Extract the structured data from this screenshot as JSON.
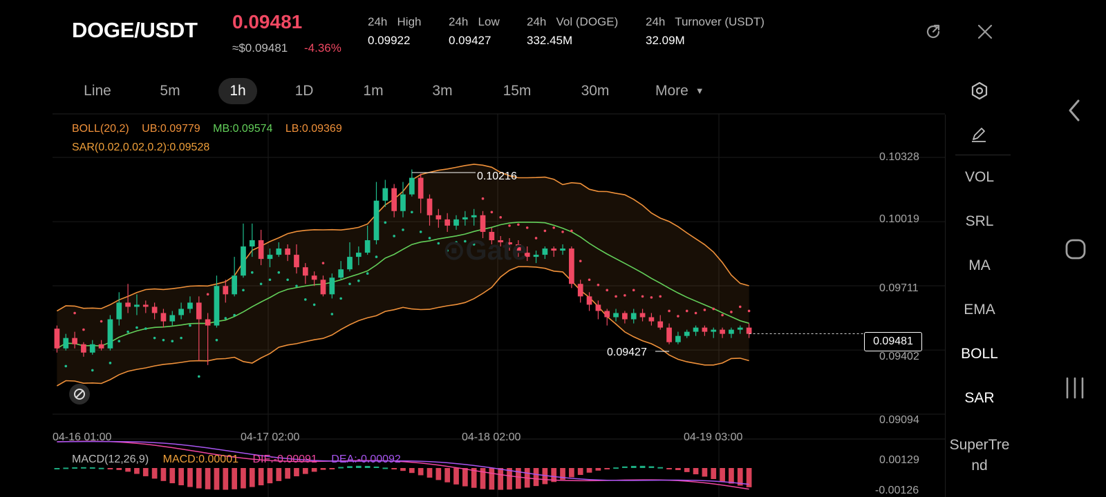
{
  "header": {
    "pair": "DOGE/USDT",
    "price": "0.09481",
    "approx": "≈$0.09481",
    "change": "-4.36%",
    "stats": [
      {
        "label": "24h   High",
        "value": "0.09922"
      },
      {
        "label": "24h   Low",
        "value": "0.09427"
      },
      {
        "label": "24h   Vol (DOGE)",
        "value": "332.45M"
      },
      {
        "label": "24h   Turnover (USDT)",
        "value": "32.09M"
      }
    ],
    "icons": {
      "refresh": "rotate-icon",
      "close": "close-icon"
    }
  },
  "tabs": [
    "Line",
    "5m",
    "1h",
    "1D",
    "1m",
    "3m",
    "15m",
    "30m",
    "More"
  ],
  "active_tab": "1h",
  "indicators": [
    "VOL",
    "SRL",
    "MA",
    "EMA",
    "BOLL",
    "SAR",
    "SuperTrend"
  ],
  "active_indicators": [
    "BOLL",
    "SAR"
  ],
  "legend": {
    "boll": "BOLL(20,2)",
    "ub": "UB:0.09779",
    "mb": "MB:0.09574",
    "lb": "LB:0.09369",
    "sar": "SAR(0.02,0.02,0.2):0.09528",
    "macd_name": "MACD(12,26,9)",
    "macd": "MACD:0.00001",
    "dif": "DIF:-0.00091",
    "dea": "DEA:-0.00092"
  },
  "chart_data": {
    "type": "candlestick",
    "ylim": [
      0.09094,
      0.10328
    ],
    "y_ticks": [
      "0.10328",
      "0.10019",
      "0.09711",
      "0.09402",
      "0.09094"
    ],
    "x_ticks": [
      "04-16 01:00",
      "04-17 02:00",
      "04-18 02:00",
      "04-19 03:00"
    ],
    "high_marker": "0.10216",
    "low_marker": "0.09427",
    "last_price": "0.09481",
    "macd_ticks": [
      "0.00129",
      "-0.00126"
    ],
    "candles": [
      [
        0.09505,
        0.0941,
        0.0952,
        0.0939
      ],
      [
        0.0941,
        0.0946,
        0.0948,
        0.094
      ],
      [
        0.0946,
        0.0943,
        0.0949,
        0.0941
      ],
      [
        0.0943,
        0.0939,
        0.0944,
        0.0937
      ],
      [
        0.0939,
        0.0943,
        0.0945,
        0.0938
      ],
      [
        0.0943,
        0.0941,
        0.0945,
        0.094
      ],
      [
        0.0941,
        0.0955,
        0.0957,
        0.094
      ],
      [
        0.0955,
        0.0963,
        0.0968,
        0.0952
      ],
      [
        0.0963,
        0.0961,
        0.0972,
        0.0958
      ],
      [
        0.0961,
        0.0962,
        0.0967,
        0.0957
      ],
      [
        0.0962,
        0.0961,
        0.0964,
        0.0958
      ],
      [
        0.0961,
        0.0958,
        0.0963,
        0.0955
      ],
      [
        0.0958,
        0.0954,
        0.096,
        0.0951
      ],
      [
        0.0954,
        0.0957,
        0.0959,
        0.0952
      ],
      [
        0.0957,
        0.096,
        0.0963,
        0.0955
      ],
      [
        0.096,
        0.0963,
        0.0966,
        0.0958
      ],
      [
        0.0963,
        0.0955,
        0.0966,
        0.0935
      ],
      [
        0.0955,
        0.0952,
        0.0958,
        0.0933
      ],
      [
        0.0952,
        0.0971,
        0.0976,
        0.0951
      ],
      [
        0.0971,
        0.0967,
        0.0974,
        0.0963
      ],
      [
        0.0967,
        0.0976,
        0.0985,
        0.0966
      ],
      [
        0.0976,
        0.099,
        0.1001,
        0.0975
      ],
      [
        0.099,
        0.0993,
        0.1001,
        0.0985
      ],
      [
        0.0993,
        0.0984,
        0.0998,
        0.0981
      ],
      [
        0.0984,
        0.0986,
        0.0989,
        0.098
      ],
      [
        0.0986,
        0.0989,
        0.0992,
        0.0985
      ],
      [
        0.0989,
        0.0986,
        0.0991,
        0.0983
      ],
      [
        0.0986,
        0.098,
        0.0991,
        0.0977
      ],
      [
        0.098,
        0.0976,
        0.0982,
        0.0972
      ],
      [
        0.0976,
        0.0974,
        0.0978,
        0.0971
      ],
      [
        0.0974,
        0.0967,
        0.0976,
        0.0966
      ],
      [
        0.0967,
        0.0975,
        0.0977,
        0.0965
      ],
      [
        0.0975,
        0.0979,
        0.0983,
        0.0974
      ],
      [
        0.0979,
        0.0985,
        0.0992,
        0.0978
      ],
      [
        0.0985,
        0.0987,
        0.099,
        0.0981
      ],
      [
        0.0987,
        0.0993,
        0.1,
        0.0986
      ],
      [
        0.0993,
        0.1012,
        0.1021,
        0.0991
      ],
      [
        0.1012,
        0.1018,
        0.1022,
        0.1009
      ],
      [
        0.1018,
        0.1007,
        0.102,
        0.1004
      ],
      [
        0.1007,
        0.1015,
        0.1021,
        0.1004
      ],
      [
        0.1015,
        0.1023,
        0.1027,
        0.1014
      ],
      [
        0.1023,
        0.1013,
        0.1025,
        0.1006
      ],
      [
        0.1013,
        0.1005,
        0.1015,
        0.1
      ],
      [
        0.1005,
        0.1003,
        0.1008,
        0.0999
      ],
      [
        0.1003,
        0.1,
        0.1006,
        0.0997
      ],
      [
        0.1,
        0.1003,
        0.1005,
        0.0998
      ],
      [
        0.1003,
        0.1004,
        0.1007,
        0.1
      ],
      [
        0.1004,
        0.1005,
        0.1008,
        0.1
      ],
      [
        0.1005,
        0.0997,
        0.1007,
        0.0994
      ],
      [
        0.0997,
        0.0993,
        0.0999,
        0.0991
      ],
      [
        0.0993,
        0.0992,
        0.0995,
        0.099
      ],
      [
        0.0992,
        0.0991,
        0.0994,
        0.0988
      ],
      [
        0.0991,
        0.0987,
        0.0993,
        0.0985
      ],
      [
        0.0987,
        0.0985,
        0.099,
        0.0983
      ],
      [
        0.0985,
        0.0986,
        0.0988,
        0.0982
      ],
      [
        0.0986,
        0.0989,
        0.099,
        0.0984
      ],
      [
        0.0989,
        0.0988,
        0.099,
        0.0985
      ],
      [
        0.0988,
        0.0989,
        0.0991,
        0.0986
      ],
      [
        0.0989,
        0.0972,
        0.099,
        0.097
      ],
      [
        0.0972,
        0.0966,
        0.0974,
        0.0963
      ],
      [
        0.0966,
        0.0962,
        0.0968,
        0.0959
      ],
      [
        0.0962,
        0.0959,
        0.0964,
        0.0955
      ],
      [
        0.0959,
        0.0956,
        0.096,
        0.0952
      ],
      [
        0.0956,
        0.0958,
        0.096,
        0.0954
      ],
      [
        0.0958,
        0.0955,
        0.0959,
        0.0953
      ],
      [
        0.0955,
        0.0958,
        0.096,
        0.0953
      ],
      [
        0.0958,
        0.0956,
        0.096,
        0.0954
      ],
      [
        0.0956,
        0.0954,
        0.0958,
        0.0952
      ],
      [
        0.0954,
        0.0951,
        0.0957,
        0.095
      ],
      [
        0.0951,
        0.0944,
        0.0953,
        0.0943
      ],
      [
        0.0944,
        0.0947,
        0.0949,
        0.0943
      ],
      [
        0.0947,
        0.0949,
        0.095,
        0.0946
      ],
      [
        0.0949,
        0.0951,
        0.0952,
        0.0947
      ],
      [
        0.0951,
        0.0949,
        0.0952,
        0.0947
      ],
      [
        0.0949,
        0.095,
        0.0951,
        0.0946
      ],
      [
        0.095,
        0.0948,
        0.0951,
        0.0946
      ],
      [
        0.0948,
        0.095,
        0.0951,
        0.0946
      ],
      [
        0.095,
        0.0951,
        0.0952,
        0.0948
      ],
      [
        0.0951,
        0.0948,
        0.0953,
        0.0946
      ]
    ]
  },
  "colors": {
    "up": "#1fbf8f",
    "down": "#f04862",
    "boll_band": "#f0913a",
    "mid": "#63d05a",
    "sar": "#f04862",
    "sar_up": "#1fbf8f",
    "boll_text": "#f0913a",
    "dif": "#f046a0",
    "dea": "#a855f0",
    "macd_text": "#f0a03a"
  }
}
